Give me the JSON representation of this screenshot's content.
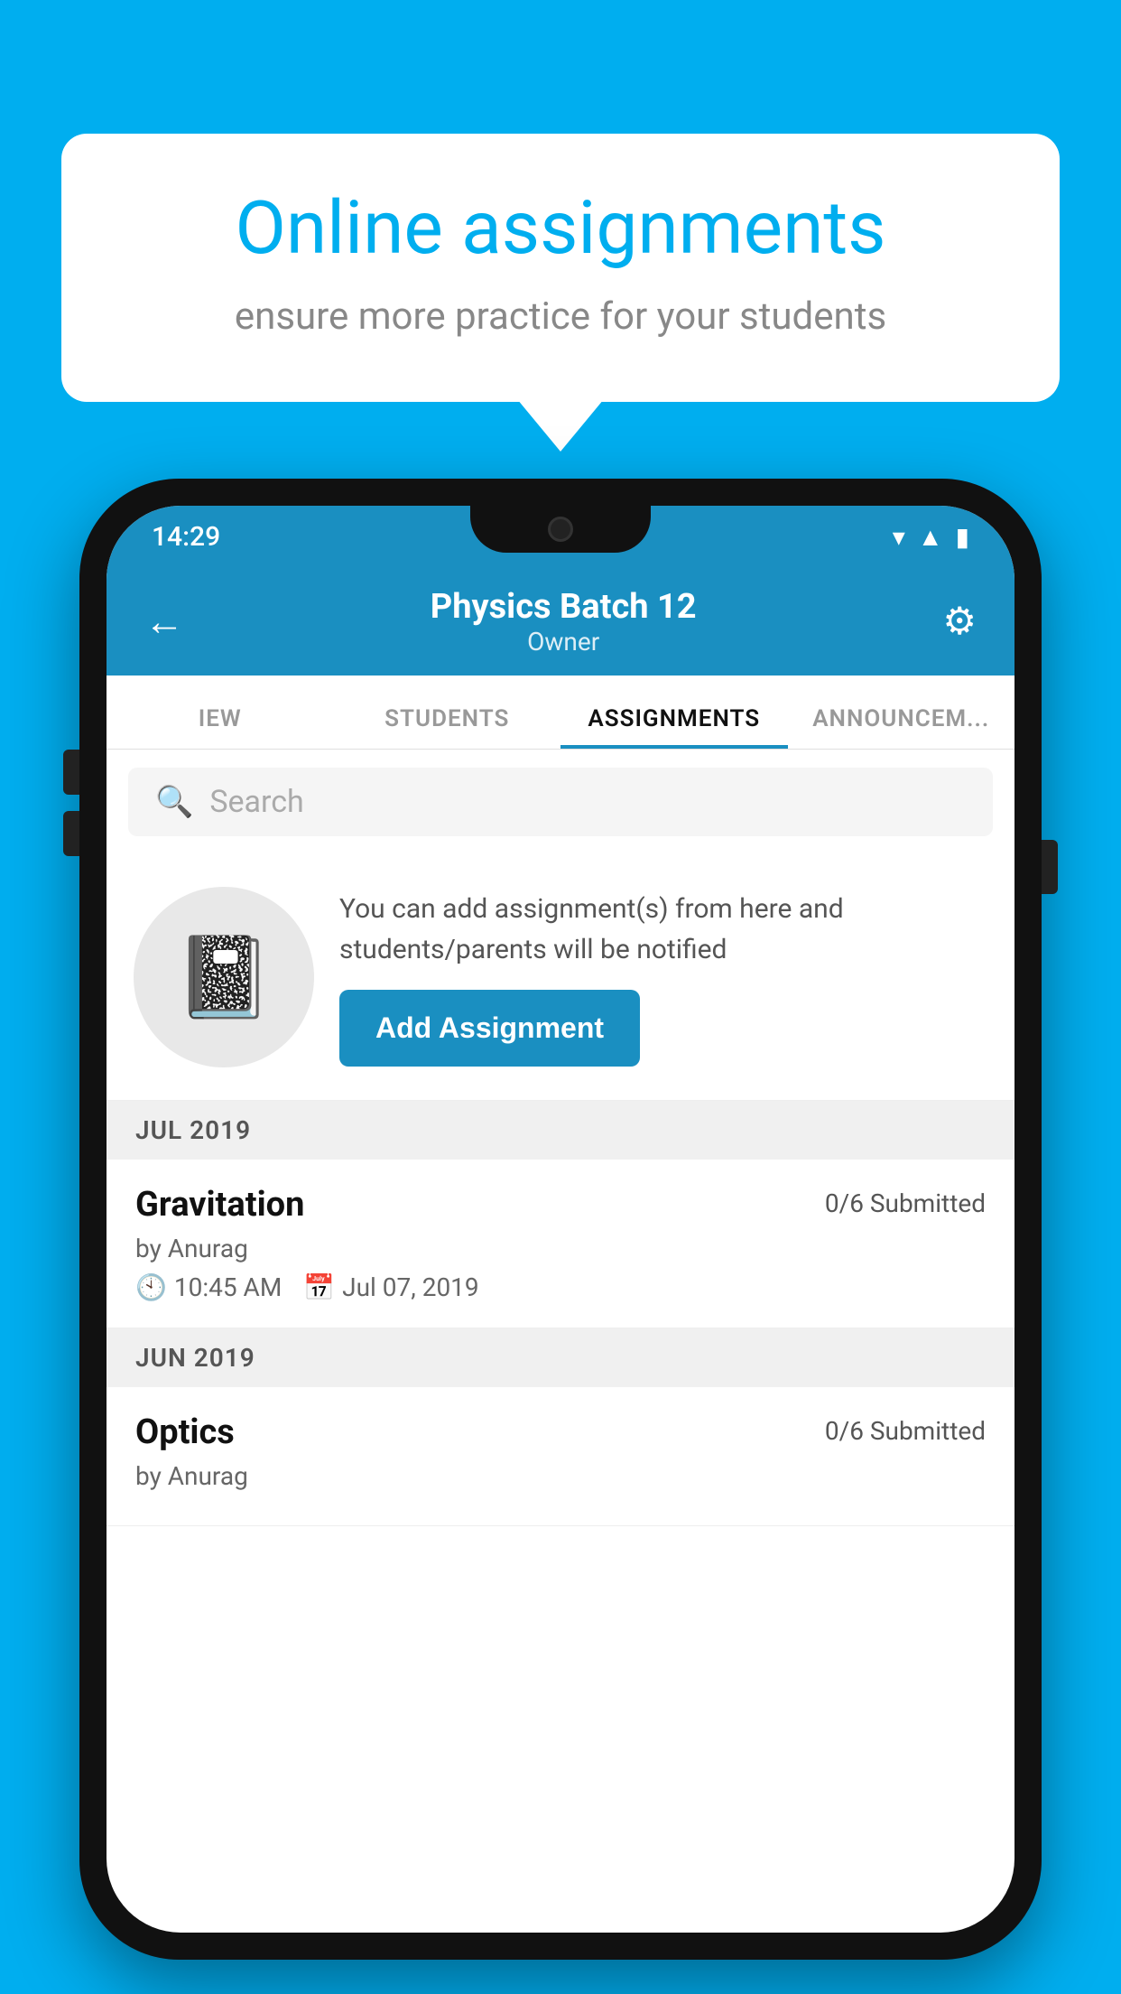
{
  "background_color": "#00AEEF",
  "speech_bubble": {
    "title": "Online assignments",
    "subtitle": "ensure more practice for your students"
  },
  "status_bar": {
    "time": "14:29",
    "icons": [
      "wifi",
      "signal",
      "battery"
    ]
  },
  "app_header": {
    "title": "Physics Batch 12",
    "subtitle": "Owner",
    "back_label": "←",
    "settings_label": "⚙"
  },
  "tabs": [
    {
      "label": "IEW",
      "active": false
    },
    {
      "label": "STUDENTS",
      "active": false
    },
    {
      "label": "ASSIGNMENTS",
      "active": true
    },
    {
      "label": "ANNOUNCEM...",
      "active": false
    }
  ],
  "search": {
    "placeholder": "Search"
  },
  "promo": {
    "description": "You can add assignment(s) from here and students/parents will be notified",
    "button_label": "Add Assignment"
  },
  "sections": [
    {
      "header": "JUL 2019",
      "assignments": [
        {
          "name": "Gravitation",
          "submitted": "0/6 Submitted",
          "author": "by Anurag",
          "time": "10:45 AM",
          "date": "Jul 07, 2019"
        }
      ]
    },
    {
      "header": "JUN 2019",
      "assignments": [
        {
          "name": "Optics",
          "submitted": "0/6 Submitted",
          "author": "by Anurag",
          "time": "",
          "date": ""
        }
      ]
    }
  ]
}
